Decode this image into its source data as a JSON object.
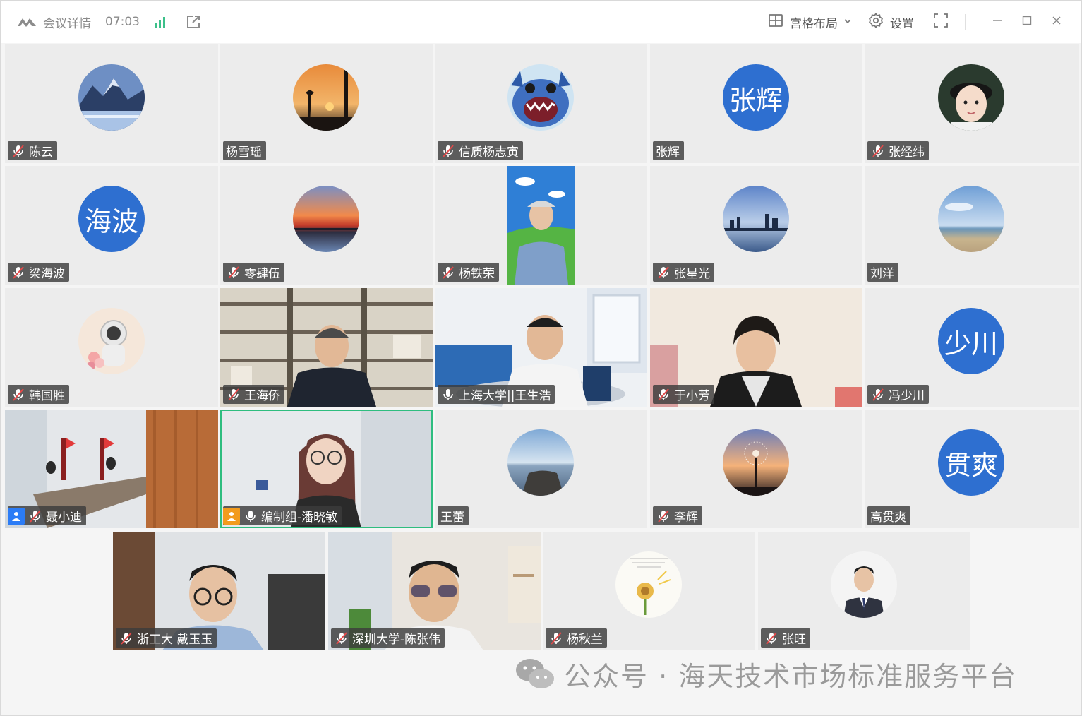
{
  "titlebar": {
    "title": "会议详情",
    "elapsed_time": "07:03",
    "layout_label": "宫格布局",
    "settings_label": "设置"
  },
  "participants": [
    {
      "name": "陈云",
      "muted": true
    },
    {
      "name": "杨雪瑶",
      "muted": false
    },
    {
      "name": "信质杨志寅",
      "muted": true
    },
    {
      "name": "张辉",
      "muted": false,
      "avatar_text": "张辉"
    },
    {
      "name": "张经纬",
      "muted": true
    },
    {
      "name": "梁海波",
      "muted": true,
      "avatar_text": "海波"
    },
    {
      "name": "零肆伍",
      "muted": true
    },
    {
      "name": "杨铁荣",
      "muted": true
    },
    {
      "name": "张星光",
      "muted": true
    },
    {
      "name": "刘洋",
      "muted": false
    },
    {
      "name": "韩国胜",
      "muted": true
    },
    {
      "name": "王海侨",
      "muted": true
    },
    {
      "name": "上海大学||王生浩",
      "muted": false
    },
    {
      "name": "于小芳",
      "muted": true
    },
    {
      "name": "冯少川",
      "muted": true,
      "avatar_text": "少川"
    },
    {
      "name": "聂小迪",
      "muted": true,
      "role": "co-host"
    },
    {
      "name": "编制组-潘晓敏",
      "muted": false,
      "role": "host",
      "speaking": true
    },
    {
      "name": "王蕾",
      "muted": false
    },
    {
      "name": "李辉",
      "muted": true
    },
    {
      "name": "高贯爽",
      "muted": false,
      "avatar_text": "贯爽"
    },
    {
      "name": "浙工大 戴玉玉",
      "muted": true
    },
    {
      "name": "深圳大学-陈张伟",
      "muted": true
    },
    {
      "name": "杨秋兰",
      "muted": true
    },
    {
      "name": "张旺",
      "muted": true
    }
  ],
  "watermark": {
    "text": "公众号 · 海天技术市场标准服务平台"
  },
  "colors": {
    "avatar_blue": "#2e6fd0",
    "active_speaker_border": "#2ebd7f",
    "host_badge": "#f29b1d",
    "cohost_badge": "#2b7cf6"
  }
}
